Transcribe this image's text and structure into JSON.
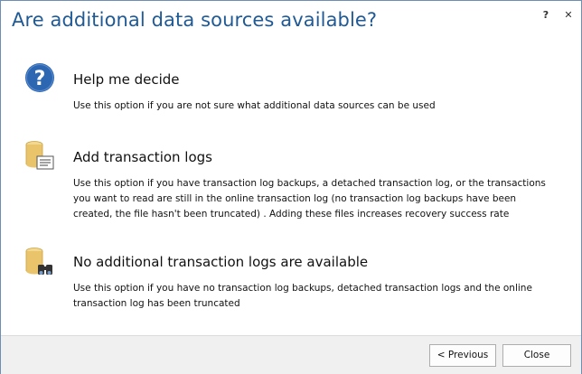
{
  "dialog": {
    "title": "Are additional data sources available?",
    "help_glyph": "?",
    "close_glyph": "✕"
  },
  "options": [
    {
      "icon": "question-circle-icon",
      "title": "Help me decide",
      "description": "Use this option if you are not sure what additional data sources can be used"
    },
    {
      "icon": "database-document-icon",
      "title": "Add transaction logs",
      "description": "Use this option if you have transaction log backups, a detached transaction log, or the transactions you want to read are still in the online transaction log (no transaction log backups have been created, the file hasn't been truncated) . Adding these files increases recovery success rate"
    },
    {
      "icon": "database-binoculars-icon",
      "title": "No additional transaction logs are available",
      "description": "Use this option if you have no transaction log backups, detached transaction logs and the online transaction log has been truncated"
    }
  ],
  "footer": {
    "previous_label": "< Previous",
    "close_label": "Close"
  },
  "colors": {
    "title": "#1f5a96",
    "icon_blue": "#2e67b1",
    "db_yellow": "#e9c46a"
  }
}
